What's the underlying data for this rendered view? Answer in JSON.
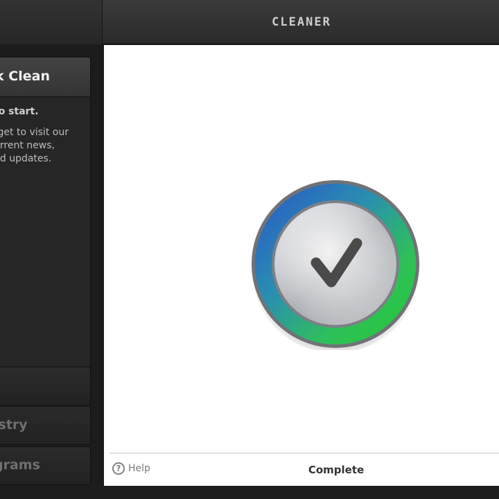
{
  "window": {
    "title": "CLEANER"
  },
  "sidebar": {
    "panel": {
      "title": "k Clean",
      "start_text": "to start.",
      "body_lines": [
        "rget to visit our",
        "urrent news,",
        "nd updates."
      ]
    },
    "items": [
      {
        "label": ""
      },
      {
        "label": "istry"
      },
      {
        "label": "grams"
      }
    ]
  },
  "main": {
    "check_icon": "checkmark-icon",
    "help_label": "Help",
    "help_icon": "help-icon",
    "status": "Complete"
  },
  "colors": {
    "ring_blue": "#2a57c9",
    "ring_green": "#2ecb3a",
    "check": "#4a4a4a"
  }
}
